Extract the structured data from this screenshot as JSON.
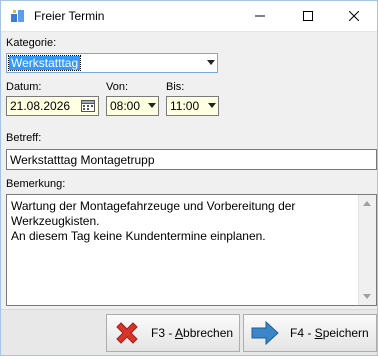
{
  "window": {
    "title": "Freier Termin"
  },
  "form": {
    "kategorie_label": "Kategorie:",
    "kategorie_value": "Werkstatttag",
    "datum_label": "Datum:",
    "datum_value": "21.08.2026",
    "von_label": "Von:",
    "von_value": "08:00",
    "bis_label": "Bis:",
    "bis_value": "11:00",
    "betreff_label": "Betreff:",
    "betreff_value": "Werkstatttag Montagetrupp",
    "bemerkung_label": "Bemerkung:",
    "bemerkung_lines": [
      "Wartung der Montagefahrzeuge und Vorbereitung der",
      "Werkzeugkisten.",
      "An diesem Tag keine Kundentermine einplanen."
    ]
  },
  "buttons": {
    "cancel_prefix": "F3 - ",
    "cancel_accel": "A",
    "cancel_rest": "bbrechen",
    "save_prefix": "F4 - ",
    "save_accel": "S",
    "save_rest": "peichern"
  },
  "colors": {
    "input_highlight": "#ffffe1",
    "selection": "#3399ff",
    "cancel_icon": "#d9342b",
    "save_icon": "#3a86c8"
  }
}
